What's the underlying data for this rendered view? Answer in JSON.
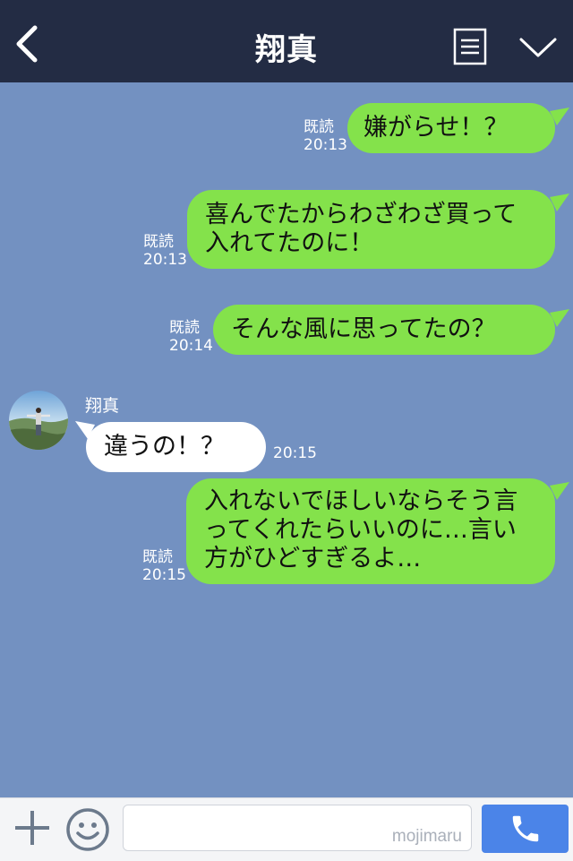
{
  "header": {
    "title": "翔真"
  },
  "messages": [
    {
      "side": "out",
      "read": "既読",
      "time": "20:13",
      "text": "嫌がらせ！？"
    },
    {
      "side": "out",
      "read": "既読",
      "time": "20:13",
      "text": "喜んでたからわざわざ買って入れてたのに！"
    },
    {
      "side": "out",
      "read": "既読",
      "time": "20:14",
      "text": "そんな風に思ってたの？"
    },
    {
      "side": "in",
      "sender": "翔真",
      "time": "20:15",
      "text": "違うの！？"
    },
    {
      "side": "out",
      "read": "既読",
      "time": "20:15",
      "text": "入れないでほしいならそう言ってくれたらいいのに…言い方がひどすぎるよ…"
    }
  ],
  "composer": {
    "watermark": "mojimaru"
  },
  "colors": {
    "header_bg": "#232c44",
    "chat_bg": "#7391c1",
    "outgoing_bubble": "#84e24b",
    "incoming_bubble": "#ffffff",
    "call_button": "#4b84e8"
  },
  "icons": [
    "back-arrow-icon",
    "menu-list-icon",
    "chevron-down-icon",
    "plus-icon",
    "emoji-icon",
    "phone-icon"
  ]
}
